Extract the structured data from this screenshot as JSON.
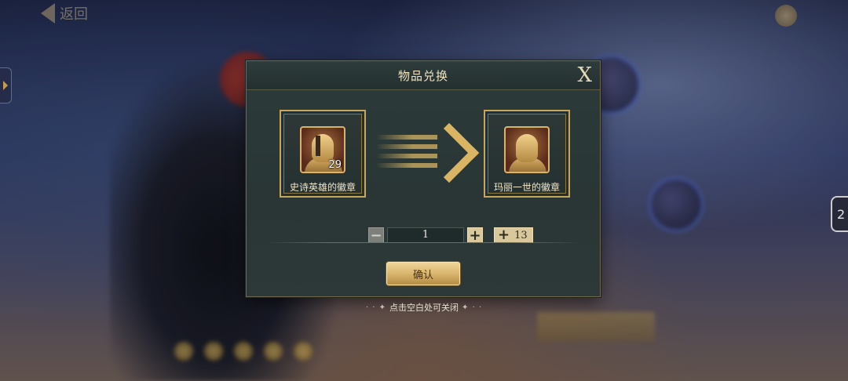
{
  "background": {
    "back_label": "返回",
    "top_right_label": "",
    "right_card_number": "2"
  },
  "dialog": {
    "title": "物品兑换",
    "close_label": "X",
    "source_item": {
      "name": "史诗英雄的徽章",
      "count": "29"
    },
    "target_item": {
      "name": "玛丽一世的徽章"
    },
    "quantity": {
      "minus": "−",
      "value": "1",
      "plus": "+"
    },
    "max_button": {
      "plus": "+",
      "value": "13"
    },
    "confirm_label": "确认"
  },
  "hint": "点击空白处可关闭",
  "colors": {
    "gold": "#d9b463",
    "panel": "#2c3a3a"
  }
}
